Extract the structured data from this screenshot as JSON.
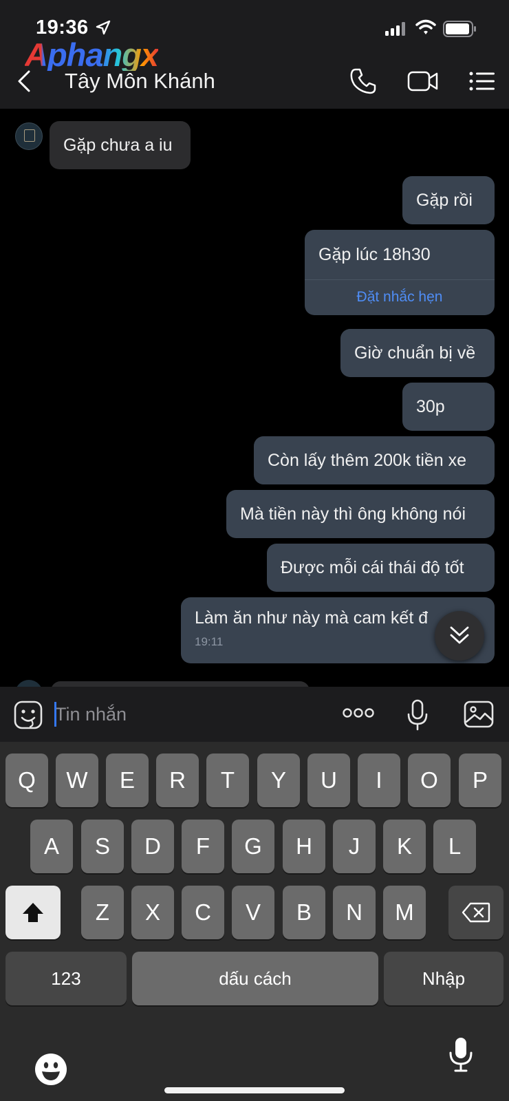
{
  "status_bar": {
    "time": "19:36"
  },
  "watermark": {
    "text": "Aphangx"
  },
  "header": {
    "title": "Tây Môn Khánh"
  },
  "messages": [
    {
      "text": "Gặp chưa a iu",
      "direction": "incoming"
    },
    {
      "text": "Gặp rồi",
      "direction": "outgoing"
    },
    {
      "text": "Gặp lúc 18h30",
      "direction": "outgoing",
      "action": "Đặt nhắc hẹn"
    },
    {
      "text": "Giờ chuẩn bị về",
      "direction": "outgoing"
    },
    {
      "text": "30p",
      "direction": "outgoing"
    },
    {
      "text": "Còn lấy thêm 200k tiền xe",
      "direction": "outgoing"
    },
    {
      "text": "Mà tiền này thì ông không nói",
      "direction": "outgoing"
    },
    {
      "text": "Được mỗi cái thái độ tốt",
      "direction": "outgoing"
    },
    {
      "text": "Làm ăn như này mà cam kết đ",
      "direction": "outgoing",
      "time": "19:11"
    }
  ],
  "composer": {
    "placeholder": "Tin nhắn"
  },
  "keyboard": {
    "row1": [
      "Q",
      "W",
      "E",
      "R",
      "T",
      "Y",
      "U",
      "I",
      "O",
      "P"
    ],
    "row2": [
      "A",
      "S",
      "D",
      "F",
      "G",
      "H",
      "J",
      "K",
      "L"
    ],
    "row3": [
      "Z",
      "X",
      "C",
      "V",
      "B",
      "N",
      "M"
    ],
    "numbers_label": "123",
    "space_label": "dấu cách",
    "return_label": "Nhập"
  },
  "colors": {
    "background": "#000000",
    "header_bg": "#1c1c1e",
    "incoming_bubble": "#2c2c2e",
    "outgoing_bubble": "#394350",
    "link": "#4f8df5",
    "key": "#6b6b6b",
    "function_key": "#464646"
  }
}
